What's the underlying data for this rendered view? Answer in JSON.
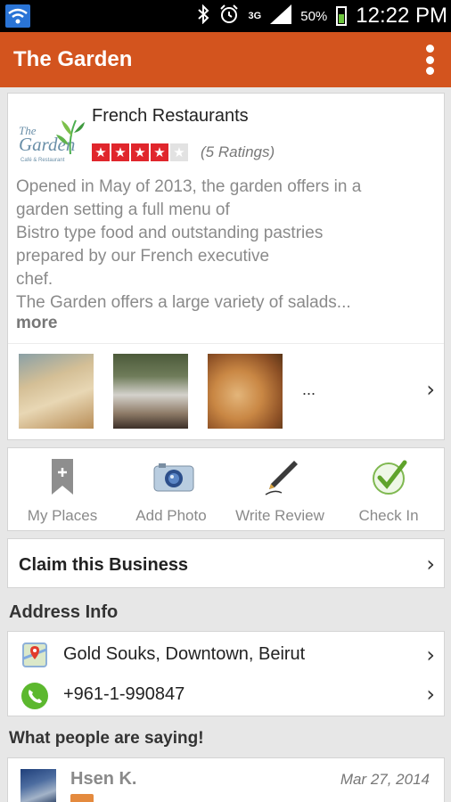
{
  "status_bar": {
    "battery": "50%",
    "network": "3G",
    "time": "12:22 PM",
    "icons": [
      "wifi-icon",
      "bluetooth-icon",
      "alarm-icon",
      "signal-icon",
      "battery-icon"
    ]
  },
  "app_bar": {
    "title": "The Garden",
    "accent_color": "#d3541e"
  },
  "business": {
    "category": "French Restaurants",
    "rating": 4,
    "rating_max": 5,
    "ratings_count_text": "(5 Ratings)",
    "description_lines": [
      "Opened in May of 2013, the garden offers in a",
      "garden setting a full menu of",
      "Bistro type food and outstanding pastries",
      "prepared by our French executive",
      "chef.",
      "The Garden offers a large variety of salads..."
    ],
    "more_label": "more",
    "photos_more": "..."
  },
  "actions": [
    {
      "label": "My Places",
      "icon": "bookmark-icon"
    },
    {
      "label": "Add Photo",
      "icon": "camera-icon"
    },
    {
      "label": "Write Review",
      "icon": "pen-icon"
    },
    {
      "label": "Check In",
      "icon": "checkmark-icon"
    }
  ],
  "claim": {
    "label": "Claim this Business"
  },
  "address_section": {
    "title": "Address Info",
    "address": "Gold Souks, Downtown, Beirut",
    "phone": "+961-1-990847"
  },
  "reviews_section": {
    "title": "What people are saying!",
    "reviews": [
      {
        "name": "Hsen K.",
        "date": "Mar 27, 2014"
      }
    ]
  }
}
